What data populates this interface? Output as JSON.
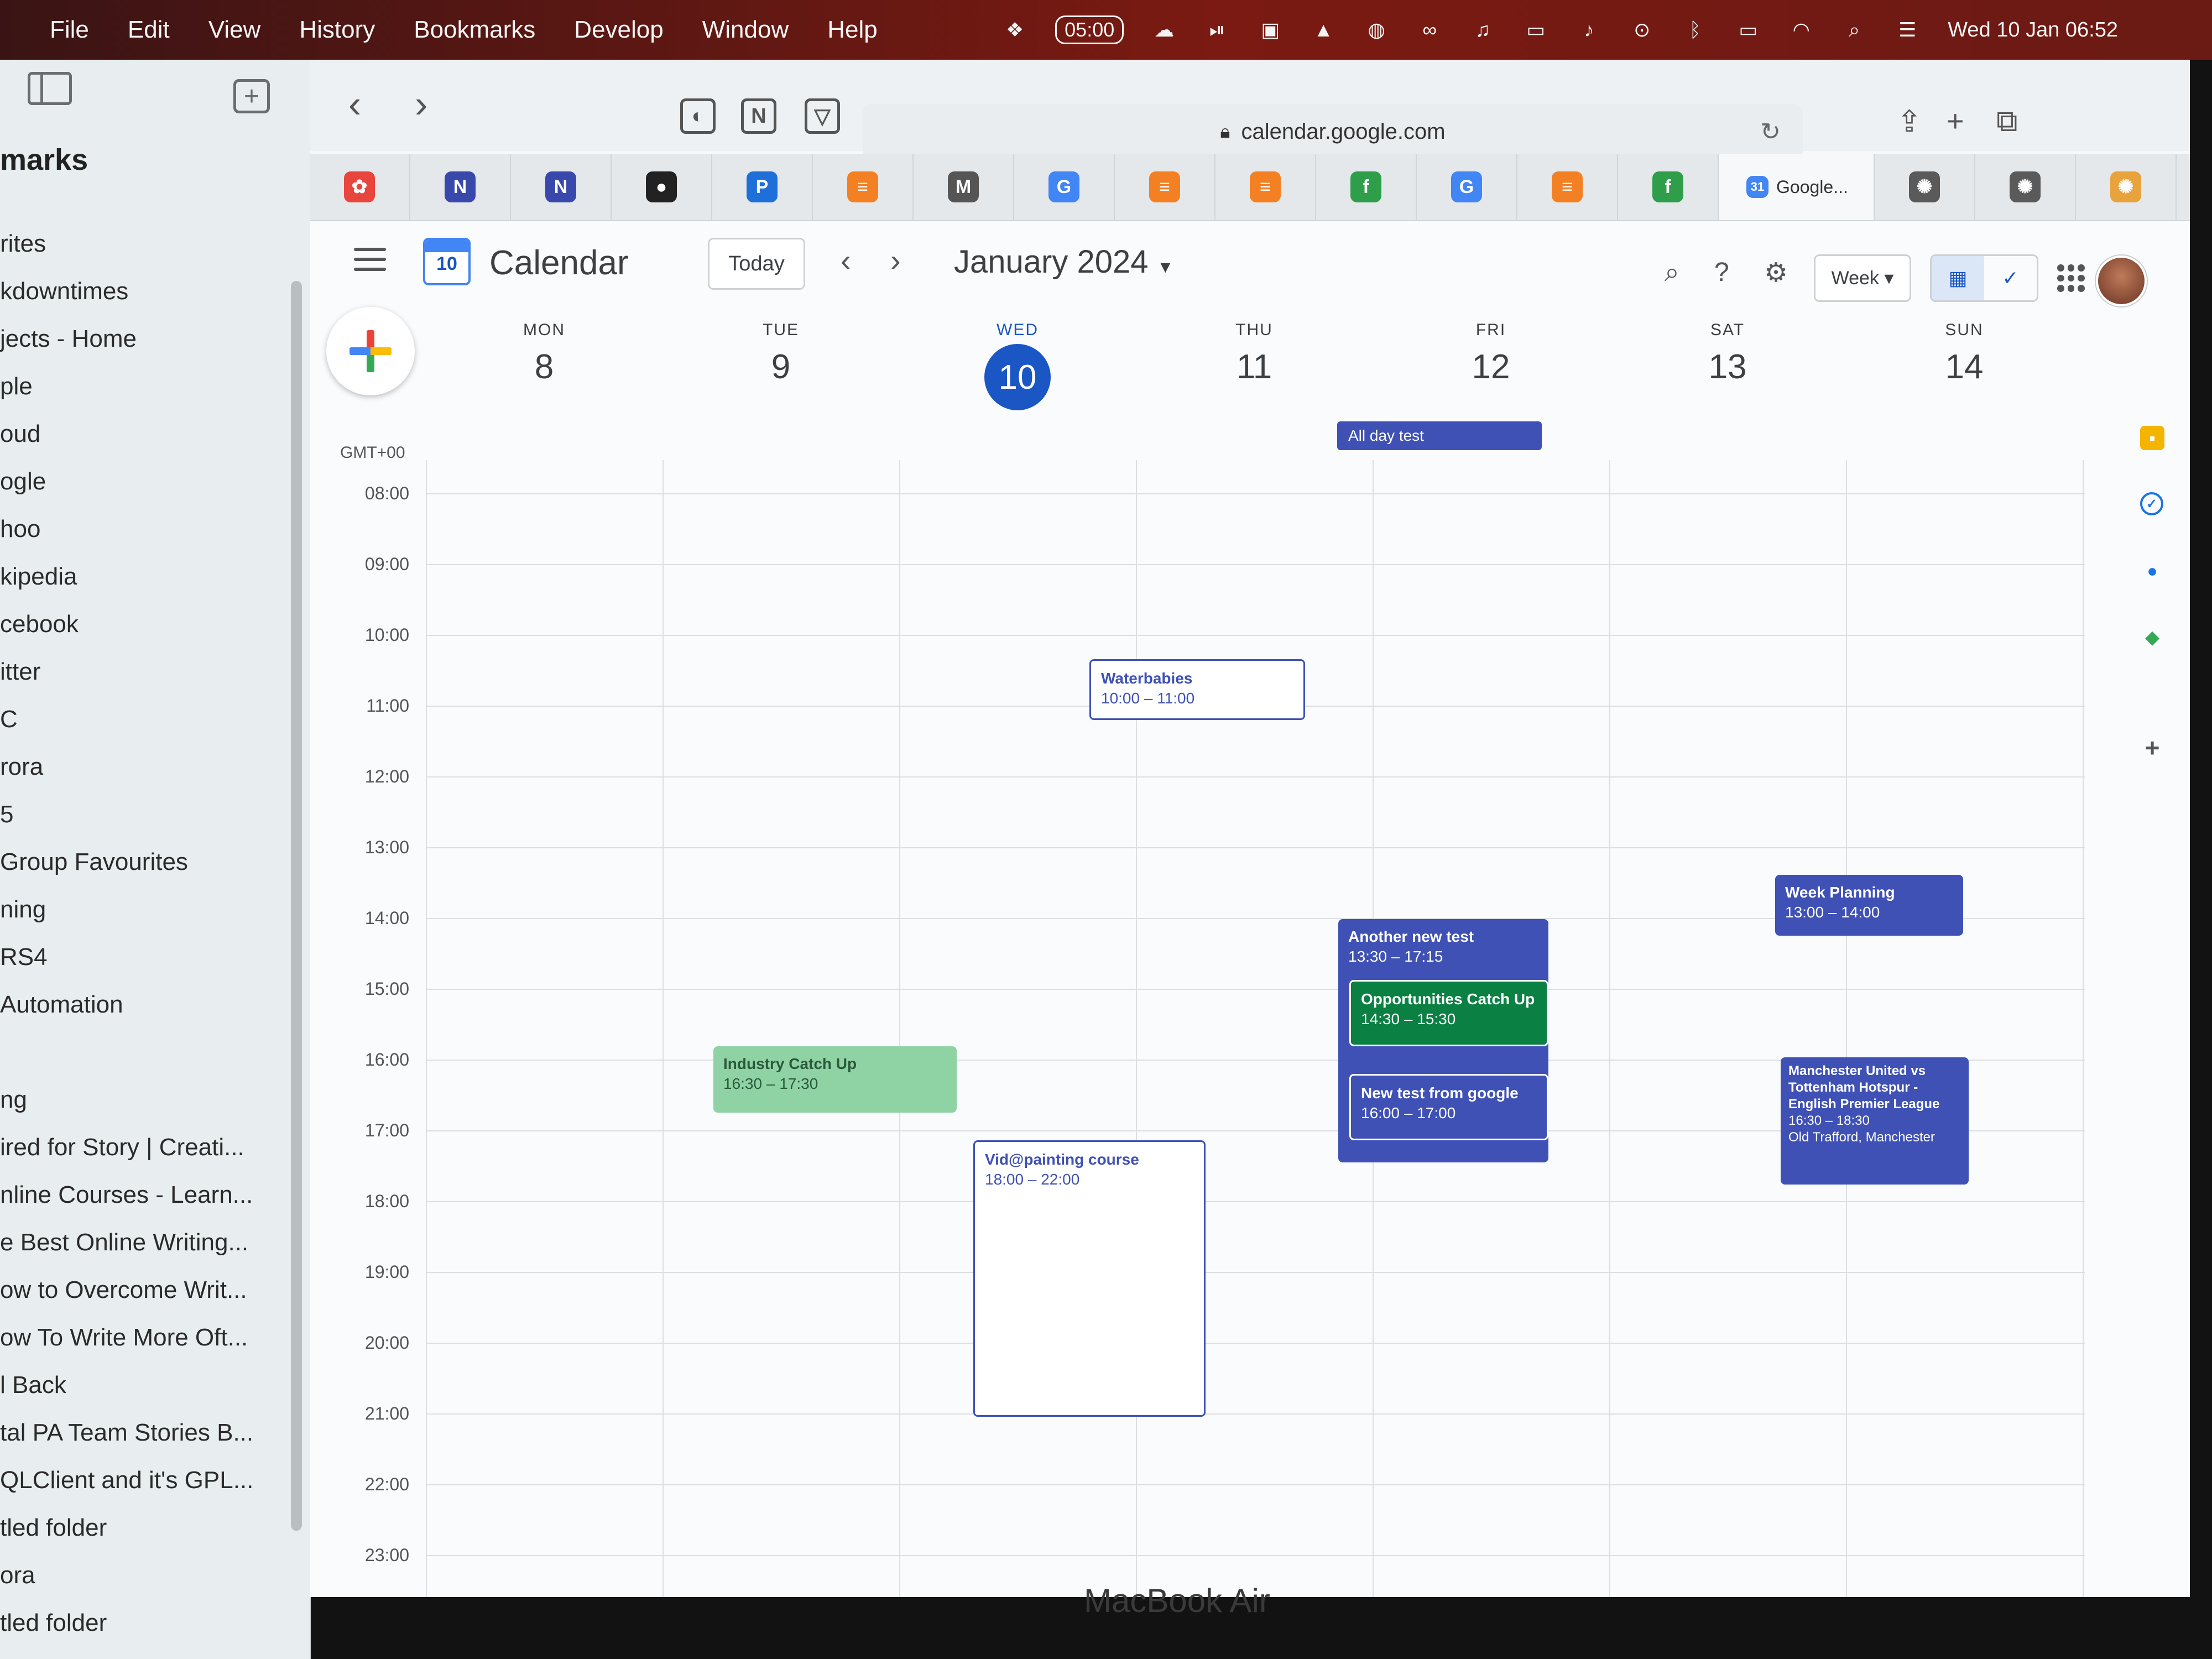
{
  "menubar": {
    "items": [
      "File",
      "Edit",
      "View",
      "History",
      "Bookmarks",
      "Develop",
      "Window",
      "Help"
    ],
    "timer": "05:00",
    "datetime": "Wed 10 Jan 06:52"
  },
  "sidebar": {
    "heading": "marks",
    "items": [
      "rites",
      "kdowntimes",
      "jects - Home",
      "ple",
      "oud",
      "ogle",
      "hoo",
      "kipedia",
      "cebook",
      "itter",
      "C",
      "rora",
      "5",
      "Group Favourites",
      "ning",
      " RS4",
      " Automation",
      "",
      "ng",
      "ired for Story | Creati...",
      "nline Courses - Learn...",
      "e Best Online Writing...",
      "ow to Overcome Writ...",
      "ow To Write More Oft...",
      "l Back",
      "tal PA Team Stories B...",
      "QLClient and it's GPL...",
      "tled folder",
      "ora",
      "tled folder"
    ]
  },
  "browser": {
    "url": "calendar.google.com",
    "active_tab_label": "Google...",
    "tabs": [
      {
        "icon": "figma-like-icon",
        "glyph": "✿",
        "color": "#e8453c"
      },
      {
        "icon": "notion-n-icon",
        "glyph": "N",
        "color": "#3949ab"
      },
      {
        "icon": "notion-n-icon",
        "glyph": "N",
        "color": "#3949ab"
      },
      {
        "icon": "github-icon",
        "glyph": "●",
        "color": "#222222"
      },
      {
        "icon": "p-icon",
        "glyph": "P",
        "color": "#1e6fd9"
      },
      {
        "icon": "stackoverflow-icon",
        "glyph": "≡",
        "color": "#f48024"
      },
      {
        "icon": "m-icon",
        "glyph": "M",
        "color": "#555555"
      },
      {
        "icon": "google-icon",
        "glyph": "G",
        "color": "#4285f4"
      },
      {
        "icon": "stackoverflow-icon",
        "glyph": "≡",
        "color": "#f48024"
      },
      {
        "icon": "stackoverflow-icon",
        "glyph": "≡",
        "color": "#f48024"
      },
      {
        "icon": "f-green-icon",
        "glyph": "f",
        "color": "#2e9e4a"
      },
      {
        "icon": "google-icon",
        "glyph": "G",
        "color": "#4285f4"
      },
      {
        "icon": "stackoverflow-icon",
        "glyph": "≡",
        "color": "#f48024"
      },
      {
        "icon": "f-green-icon",
        "glyph": "f",
        "color": "#2e9e4a"
      }
    ]
  },
  "calendar": {
    "app_title": "Calendar",
    "logo_day": "10",
    "today_label": "Today",
    "month_label": "January 2024",
    "view_label": "Week",
    "timezone": "GMT+00",
    "days": [
      {
        "name": "MON",
        "num": "8"
      },
      {
        "name": "TUE",
        "num": "9"
      },
      {
        "name": "WED",
        "num": "10",
        "today": true
      },
      {
        "name": "THU",
        "num": "11"
      },
      {
        "name": "FRI",
        "num": "12"
      },
      {
        "name": "SAT",
        "num": "13"
      },
      {
        "name": "SUN",
        "num": "14"
      }
    ],
    "hours": [
      "08:00",
      "09:00",
      "10:00",
      "11:00",
      "12:00",
      "13:00",
      "14:00",
      "15:00",
      "16:00",
      "17:00",
      "18:00",
      "19:00",
      "20:00",
      "21:00",
      "22:00",
      "23:00"
    ],
    "allday_event": "All day test",
    "events": {
      "waterbabies": {
        "title": "Waterbabies",
        "time": "10:00 – 11:00"
      },
      "industry": {
        "title": "Industry Catch Up",
        "time": "16:30 – 17:30"
      },
      "painting": {
        "title": "Vid@painting course",
        "time": "18:00 – 22:00"
      },
      "another": {
        "title": "Another new test",
        "time": "13:30 – 17:15"
      },
      "opps": {
        "title": "Opportunities Catch Up",
        "time": "14:30 – 15:30"
      },
      "newtest": {
        "title": "New test from google",
        "time": "16:00 – 17:00"
      },
      "planning": {
        "title": "Week Planning",
        "time": "13:00 – 14:00"
      },
      "football": {
        "title": "Manchester United vs Tottenham Hotspur - English Premier League",
        "time": "16:30 – 18:30",
        "location": "Old Trafford, Manchester"
      }
    }
  },
  "device_label": "MacBook Air",
  "colors": {
    "accent": "#1a56c4",
    "event_indigo": "#3f51b5",
    "event_green": "#0b8043",
    "event_mint": "#8fd3a4"
  }
}
